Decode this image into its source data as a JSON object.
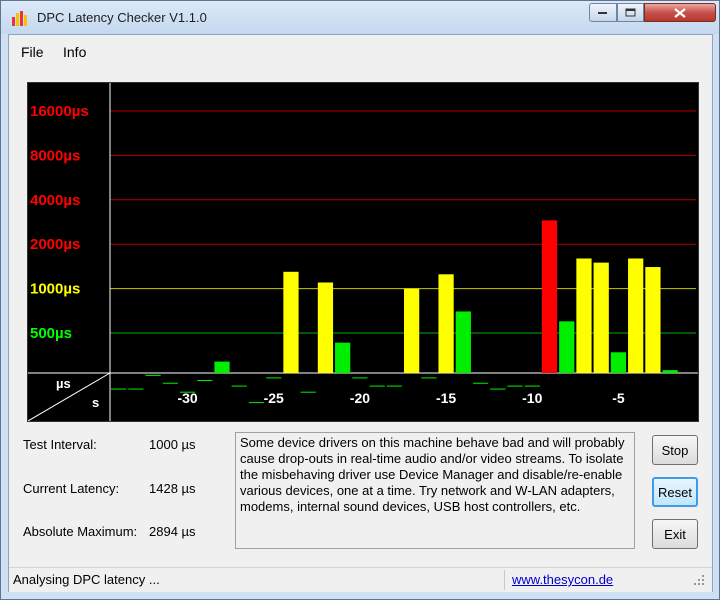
{
  "window": {
    "title": "DPC Latency Checker V1.1.0"
  },
  "menu": {
    "items": [
      "File",
      "Info"
    ]
  },
  "chart_data": {
    "type": "bar",
    "y_scale": "log2",
    "y_ticks": [
      {
        "label": "16000µs",
        "value": 16000,
        "color": "#ff0000"
      },
      {
        "label": "8000µs",
        "value": 8000,
        "color": "#ff0000"
      },
      {
        "label": "4000µs",
        "value": 4000,
        "color": "#ff0000"
      },
      {
        "label": "2000µs",
        "value": 2000,
        "color": "#ff0000"
      },
      {
        "label": "1000µs",
        "value": 1000,
        "color": "#ffff00"
      },
      {
        "label": "500µs",
        "value": 500,
        "color": "#00ff00"
      }
    ],
    "x_ticks": [
      -30,
      -25,
      -20,
      -15,
      -10,
      -5
    ],
    "x_tick_labels": [
      "-30",
      "-25",
      "-20",
      "-15",
      "-10",
      "-5"
    ],
    "corner_top": "µs",
    "corner_bottom": "s",
    "x_range": [
      -34,
      -1
    ],
    "bars": [
      {
        "x": -34,
        "us": 210
      },
      {
        "x": -33,
        "us": 210
      },
      {
        "x": -32,
        "us": 260
      },
      {
        "x": -31,
        "us": 230
      },
      {
        "x": -30,
        "us": 200
      },
      {
        "x": -29,
        "us": 240
      },
      {
        "x": -28,
        "us": 320
      },
      {
        "x": -27,
        "us": 220
      },
      {
        "x": -26,
        "us": 170
      },
      {
        "x": -25,
        "us": 250
      },
      {
        "x": -24,
        "us": 1300
      },
      {
        "x": -23,
        "us": 200
      },
      {
        "x": -22,
        "us": 1100
      },
      {
        "x": -21,
        "us": 430
      },
      {
        "x": -20,
        "us": 250
      },
      {
        "x": -19,
        "us": 220
      },
      {
        "x": -18,
        "us": 220
      },
      {
        "x": -17,
        "us": 1000
      },
      {
        "x": -16,
        "us": 250
      },
      {
        "x": -15,
        "us": 1250
      },
      {
        "x": -14,
        "us": 700
      },
      {
        "x": -13,
        "us": 230
      },
      {
        "x": -12,
        "us": 210
      },
      {
        "x": -11,
        "us": 220
      },
      {
        "x": -10,
        "us": 220
      },
      {
        "x": -9,
        "us": 2900
      },
      {
        "x": -8,
        "us": 600
      },
      {
        "x": -7,
        "us": 1600
      },
      {
        "x": -6,
        "us": 1500
      },
      {
        "x": -5,
        "us": 370
      },
      {
        "x": -4,
        "us": 1600
      },
      {
        "x": -3,
        "us": 1400
      },
      {
        "x": -2,
        "us": 280
      }
    ],
    "colors": {
      "green": "#00ee00",
      "yellow": "#ffff00",
      "red": "#ff0000",
      "background": "#000000"
    }
  },
  "stats": {
    "test_interval_label": "Test Interval:",
    "test_interval_value": "1000 µs",
    "current_latency_label": "Current Latency:",
    "current_latency_value": "1428 µs",
    "absolute_max_label": "Absolute Maximum:",
    "absolute_max_value": "2894 µs"
  },
  "message": "Some device drivers on this machine behave bad and will probably cause drop-outs in real-time audio and/or video streams. To isolate the misbehaving driver use Device Manager and disable/re-enable various devices, one at a time. Try network and W-LAN adapters, modems, internal sound devices, USB host controllers, etc.",
  "buttons": {
    "stop": "Stop",
    "reset": "Reset",
    "exit": "Exit"
  },
  "status": {
    "text": "Analysing DPC latency ...",
    "link": "www.thesycon.de"
  }
}
